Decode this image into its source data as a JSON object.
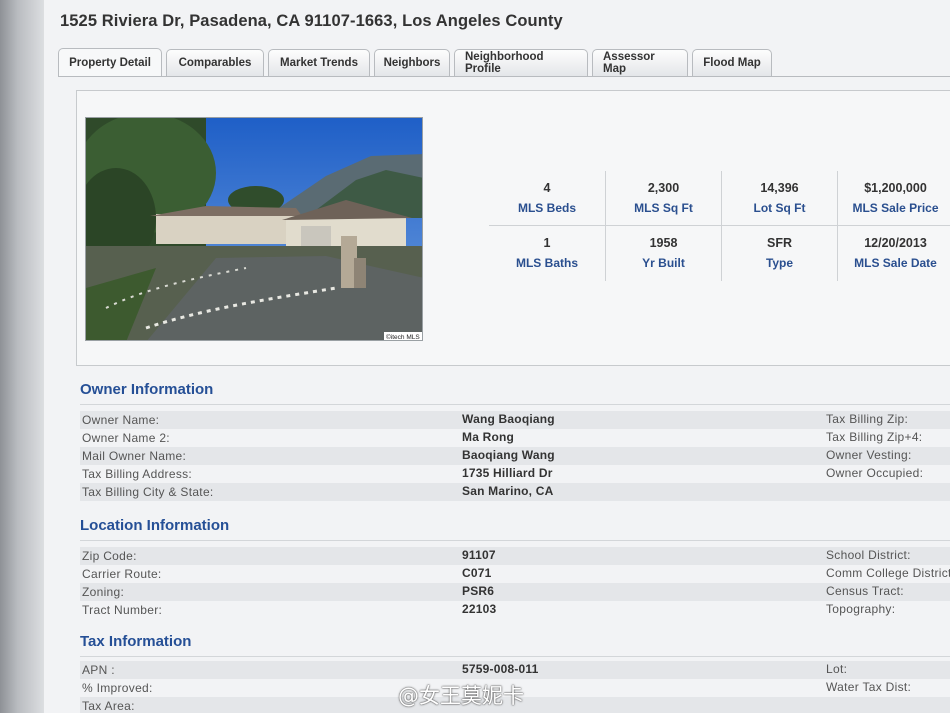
{
  "header": {
    "address": "1525 Riviera Dr, Pasadena, CA 91107-1663, Los Angeles County"
  },
  "tabs": [
    {
      "label": "Property Detail",
      "active": true
    },
    {
      "label": "Comparables"
    },
    {
      "label": "Market Trends"
    },
    {
      "label": "Neighbors"
    },
    {
      "label": "Neighborhood Profile"
    },
    {
      "label": "Assessor Map"
    },
    {
      "label": "Flood Map"
    }
  ],
  "photo": {
    "caption": "©itech MLS"
  },
  "stats": [
    {
      "value": "4",
      "label": "MLS Beds"
    },
    {
      "value": "2,300",
      "label": "MLS Sq Ft"
    },
    {
      "value": "14,396",
      "label": "Lot Sq Ft"
    },
    {
      "value": "$1,200,000",
      "label": "MLS Sale Price"
    },
    {
      "value": "1",
      "label": "MLS Baths"
    },
    {
      "value": "1958",
      "label": "Yr Built"
    },
    {
      "value": "SFR",
      "label": "Type"
    },
    {
      "value": "12/20/2013",
      "label": "MLS Sale Date"
    }
  ],
  "owner": {
    "title": "Owner Information",
    "rows": [
      {
        "label": "Owner Name:",
        "value": "Wang Baoqiang",
        "right": "Tax Billing Zip:"
      },
      {
        "label": "Owner Name 2:",
        "value": "Ma Rong",
        "right": "Tax Billing Zip+4:"
      },
      {
        "label": "Mail Owner Name:",
        "value": "Baoqiang Wang",
        "right": "Owner Vesting:"
      },
      {
        "label": "Tax Billing Address:",
        "value": "1735 Hilliard Dr",
        "right": "Owner Occupied:"
      },
      {
        "label": "Tax Billing City & State:",
        "value": "San Marino, CA",
        "right": ""
      }
    ]
  },
  "location": {
    "title": "Location Information",
    "rows": [
      {
        "label": "Zip Code:",
        "value": "91107",
        "right": "School District:"
      },
      {
        "label": "Carrier Route:",
        "value": "C071",
        "right": "Comm College District"
      },
      {
        "label": "Zoning:",
        "value": "PSR6",
        "right": "Census Tract:"
      },
      {
        "label": "Tract Number:",
        "value": "22103",
        "right": "Topography:"
      }
    ]
  },
  "tax": {
    "title": "Tax Information",
    "rows": [
      {
        "label": "APN :",
        "value": "5759-008-011",
        "right": "Lot:"
      },
      {
        "label": "% Improved:",
        "value": "",
        "right": "Water Tax Dist:"
      },
      {
        "label": "Tax Area:",
        "value": "",
        "right": ""
      }
    ]
  },
  "watermark": "@女王莫妮卡"
}
